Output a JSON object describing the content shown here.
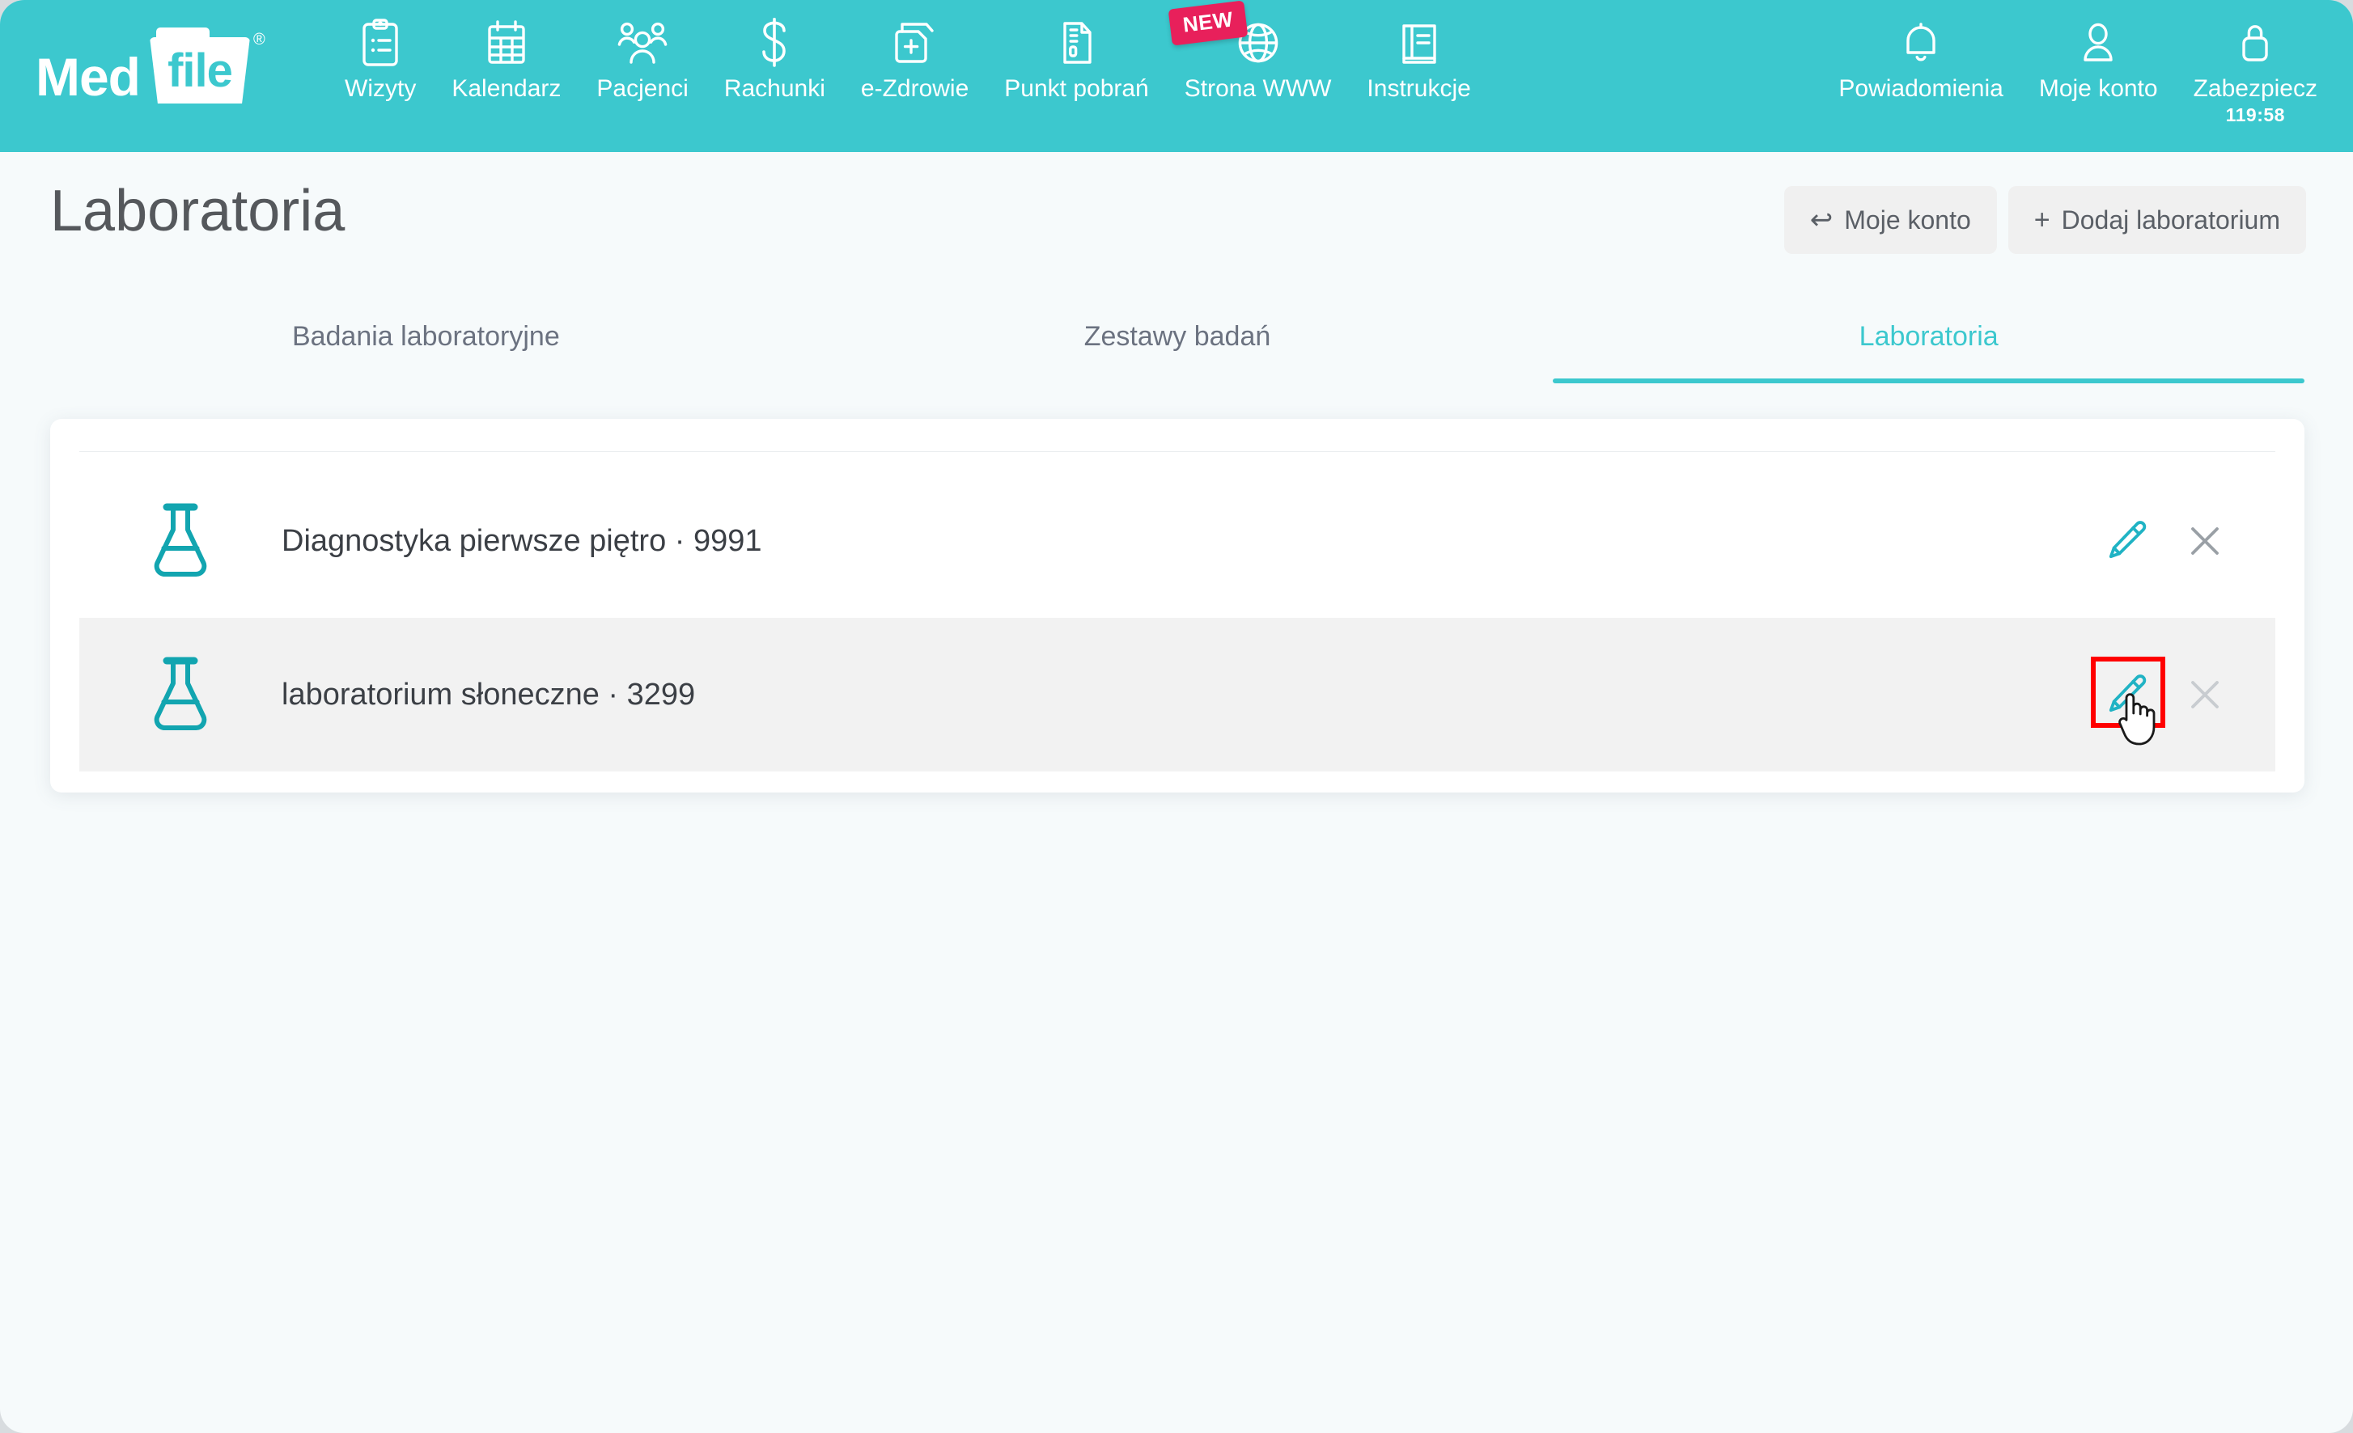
{
  "brand": {
    "name_part1": "Med",
    "name_part2": "file",
    "registered": "®"
  },
  "nav": {
    "left_items": [
      {
        "label": "Wizyty",
        "icon": "clipboard-list-icon"
      },
      {
        "label": "Kalendarz",
        "icon": "calendar-icon"
      },
      {
        "label": "Pacjenci",
        "icon": "people-group-icon"
      },
      {
        "label": "Rachunki",
        "icon": "dollar-sign-icon"
      },
      {
        "label": "e-Zdrowie",
        "icon": "document-plus-icon"
      },
      {
        "label": "Punkt pobrań",
        "icon": "document-lines-icon"
      },
      {
        "label": "Strona WWW",
        "icon": "globe-icon",
        "badge": "NEW"
      },
      {
        "label": "Instrukcje",
        "icon": "book-icon"
      }
    ],
    "right_items": [
      {
        "label": "Powiadomienia",
        "icon": "bell-icon"
      },
      {
        "label": "Moje konto",
        "icon": "user-icon"
      },
      {
        "label": "Zabezpiecz",
        "icon": "lock-icon",
        "sub": "119:58"
      }
    ]
  },
  "header": {
    "title": "Laboratoria",
    "buttons": [
      {
        "label": "Moje konto",
        "icon": "back-arrow-icon",
        "glyph": "↩"
      },
      {
        "label": "Dodaj laboratorium",
        "icon": "plus-icon",
        "glyph": "+"
      }
    ]
  },
  "tabs": [
    {
      "label": "Badania laboratoryjne",
      "active": false
    },
    {
      "label": "Zestawy badań",
      "active": false
    },
    {
      "label": "Laboratoria",
      "active": true
    }
  ],
  "laboratories": [
    {
      "label": "Diagnostyka pierwsze piętro · 9991",
      "hovered": false,
      "edit_highlighted": false
    },
    {
      "label": "laboratorium słoneczne · 3299",
      "hovered": true,
      "edit_highlighted": true
    }
  ],
  "row_actions": {
    "edit_icon": "pencil-icon",
    "delete_icon": "close-x-icon"
  },
  "colors": {
    "brand_teal": "#3cc8ce",
    "icon_teal": "#15a6b0",
    "badge_pink": "#e8205b",
    "highlight_red": "#ff0000",
    "page_background": "#f6fafb",
    "row_hover": "#f2f2f2"
  }
}
